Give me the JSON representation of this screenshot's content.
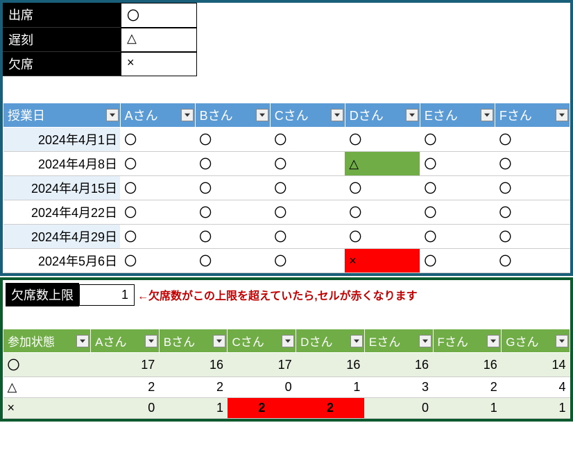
{
  "legend": {
    "present": {
      "label": "出席",
      "symbol": "〇"
    },
    "late": {
      "label": "遅刻",
      "symbol": "△"
    },
    "absent": {
      "label": "欠席",
      "symbol": "×"
    }
  },
  "topTable": {
    "headers": [
      "授業日",
      "Aさん",
      "Bさん",
      "Cさん",
      "Dさん",
      "Eさん",
      "Fさん"
    ],
    "rows": [
      {
        "date": "2024年4月1日",
        "cells": [
          {
            "v": "〇"
          },
          {
            "v": "〇"
          },
          {
            "v": "〇"
          },
          {
            "v": "〇"
          },
          {
            "v": "〇"
          },
          {
            "v": "〇"
          }
        ]
      },
      {
        "date": "2024年4月8日",
        "cells": [
          {
            "v": "〇"
          },
          {
            "v": "〇"
          },
          {
            "v": "〇"
          },
          {
            "v": "△",
            "hl": "green"
          },
          {
            "v": "〇"
          },
          {
            "v": "〇"
          }
        ]
      },
      {
        "date": "2024年4月15日",
        "cells": [
          {
            "v": "〇"
          },
          {
            "v": "〇"
          },
          {
            "v": "〇"
          },
          {
            "v": "〇"
          },
          {
            "v": "〇"
          },
          {
            "v": "〇"
          }
        ]
      },
      {
        "date": "2024年4月22日",
        "cells": [
          {
            "v": "〇"
          },
          {
            "v": "〇"
          },
          {
            "v": "〇"
          },
          {
            "v": "〇"
          },
          {
            "v": "〇"
          },
          {
            "v": "〇"
          }
        ]
      },
      {
        "date": "2024年4月29日",
        "cells": [
          {
            "v": "〇"
          },
          {
            "v": "〇"
          },
          {
            "v": "〇"
          },
          {
            "v": "〇"
          },
          {
            "v": "〇"
          },
          {
            "v": "〇"
          }
        ]
      },
      {
        "date": "2024年5月6日",
        "cells": [
          {
            "v": "〇"
          },
          {
            "v": "〇"
          },
          {
            "v": "〇"
          },
          {
            "v": "×",
            "hl": "red"
          },
          {
            "v": "〇"
          },
          {
            "v": "〇"
          }
        ]
      }
    ]
  },
  "limit": {
    "label": "欠席数上限",
    "value": "1",
    "note": "←欠席数がこの上限を超えていたら,セルが赤くなります"
  },
  "botTable": {
    "headers": [
      "参加状態",
      "Aさん",
      "Bさん",
      "Cさん",
      "Dさん",
      "Eさん",
      "Fさん",
      "Gさん"
    ],
    "rows": [
      {
        "status": "〇",
        "cells": [
          {
            "v": "17"
          },
          {
            "v": "16"
          },
          {
            "v": "17"
          },
          {
            "v": "16"
          },
          {
            "v": "16"
          },
          {
            "v": "16"
          },
          {
            "v": "14"
          }
        ]
      },
      {
        "status": "△",
        "cells": [
          {
            "v": "2"
          },
          {
            "v": "2"
          },
          {
            "v": "0"
          },
          {
            "v": "1"
          },
          {
            "v": "3"
          },
          {
            "v": "2"
          },
          {
            "v": "4"
          }
        ]
      },
      {
        "status": "×",
        "cells": [
          {
            "v": "0"
          },
          {
            "v": "1"
          },
          {
            "v": "2",
            "hl": "redbold"
          },
          {
            "v": "2",
            "hl": "redbold"
          },
          {
            "v": "0"
          },
          {
            "v": "1"
          },
          {
            "v": "1"
          }
        ]
      }
    ]
  }
}
